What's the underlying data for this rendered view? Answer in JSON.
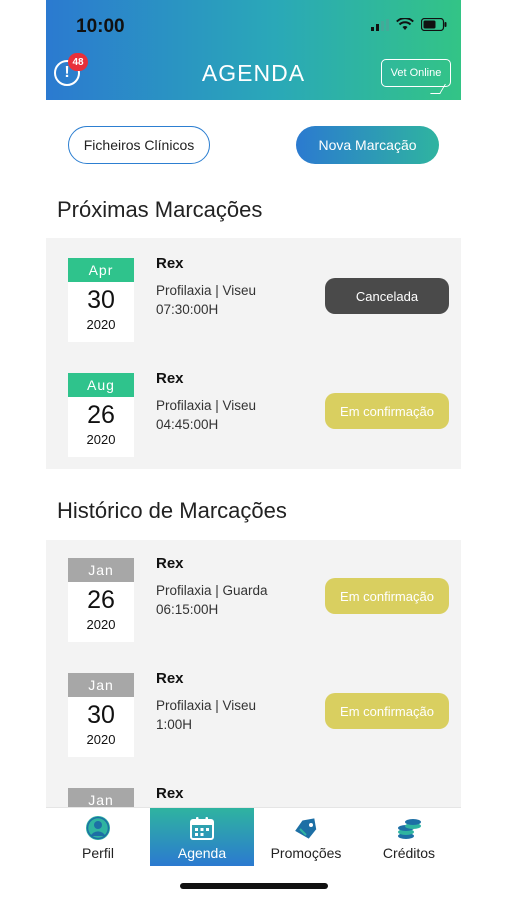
{
  "status_bar": {
    "time": "10:00"
  },
  "header": {
    "title": "AGENDA",
    "alert_count": "48",
    "alert_symbol": "!",
    "vet_online_label": "Vet Online"
  },
  "actions": {
    "ficheiros_label": "Ficheiros Clínicos",
    "nova_label": "Nova Marcação"
  },
  "sections": {
    "upcoming_title": "Próximas Marcações",
    "history_title": "Histórico de Marcações"
  },
  "upcoming": [
    {
      "month": "Apr",
      "day": "30",
      "year": "2020",
      "pet": "Rex",
      "line1": "Profilaxia | Viseu",
      "line2": "07:30:00H",
      "status": "Cancelada",
      "status_type": "cancel"
    },
    {
      "month": "Aug",
      "day": "26",
      "year": "2020",
      "pet": "Rex",
      "line1": "Profilaxia | Viseu",
      "line2": "04:45:00H",
      "status": "Em confirmação",
      "status_type": "confirm"
    }
  ],
  "history": [
    {
      "month": "Jan",
      "day": "26",
      "year": "2020",
      "pet": "Rex",
      "line1": "Profilaxia | Guarda",
      "line2": "06:15:00H",
      "status": "Em confirmação",
      "status_type": "confirm"
    },
    {
      "month": "Jan",
      "day": "30",
      "year": "2020",
      "pet": "Rex",
      "line1": "Profilaxia | Viseu",
      "line2": "1:00H",
      "status": "Em confirmação",
      "status_type": "confirm"
    },
    {
      "month": "Jan",
      "pet": "Rex"
    }
  ],
  "tabbar": {
    "items": [
      {
        "label": "Perfil",
        "icon": "profile-icon"
      },
      {
        "label": "Agenda",
        "icon": "calendar-icon",
        "active": true
      },
      {
        "label": "Promoções",
        "icon": "tag-icon"
      },
      {
        "label": "Créditos",
        "icon": "coins-icon"
      }
    ]
  },
  "colors": {
    "brand_blue": "#2b7ad0",
    "brand_green": "#33c486",
    "month_active": "#2fc38c",
    "month_past": "#a7a7a7",
    "status_cancel": "#4a4a4a",
    "status_confirm": "#d9cf60",
    "badge": "#e8303a"
  }
}
